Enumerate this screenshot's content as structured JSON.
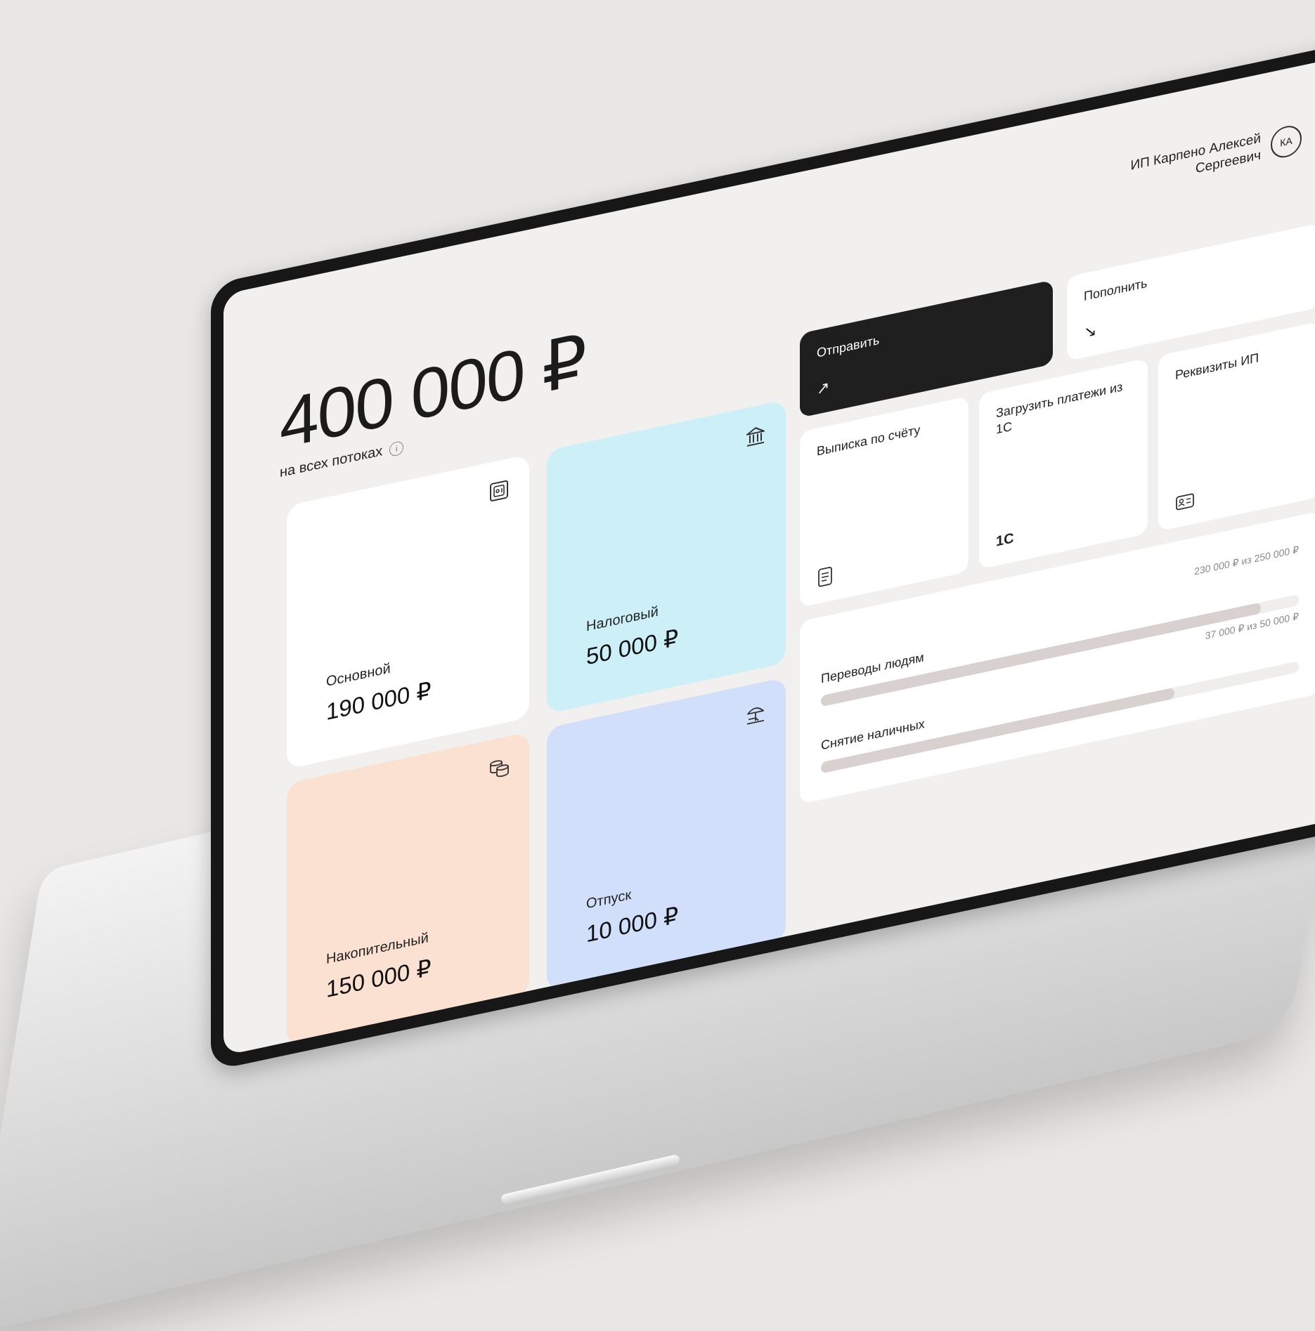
{
  "user": {
    "name_line1": "ИП Карпено Алексей",
    "name_line2": "Сергеевич",
    "initials": "КА"
  },
  "summary": {
    "total": "400 000 ₽",
    "caption": "на всех потоках",
    "info_glyph": "i"
  },
  "accounts": [
    {
      "label": "Основной",
      "amount": "190 000 ₽",
      "icon": "safe-icon",
      "color": "#ffffff"
    },
    {
      "label": "Налоговый",
      "amount": "50 000 ₽",
      "icon": "bank-icon",
      "color": "#cdeff8"
    },
    {
      "label": "Накопительный",
      "amount": "150 000 ₽",
      "icon": "coins-icon",
      "color": "#fbe1d2"
    },
    {
      "label": "Отпуск",
      "amount": "10 000 ₽",
      "icon": "beach-umbrella-icon",
      "color": "#d2dffa"
    }
  ],
  "actions": {
    "send": {
      "label": "Отправить",
      "icon": "arrow-up-right-icon",
      "glyph": "↗"
    },
    "topup": {
      "label": "Пополнить",
      "icon": "arrow-down-right-icon",
      "glyph": "↘"
    },
    "statement": {
      "label": "Выписка по счёту",
      "icon": "document-icon"
    },
    "import_1c": {
      "label": "Загрузить платежи из 1С",
      "icon": "1c-icon",
      "glyph": "1С"
    },
    "requisites": {
      "label": "Реквизиты ИП",
      "icon": "id-card-icon"
    }
  },
  "limits": [
    {
      "name": "Переводы людям",
      "text": "230 000 ₽ из 250 000 ₽",
      "used": 230000,
      "total": 250000
    },
    {
      "name": "Снятие наличных",
      "text": "37 000 ₽ из 50 000 ₽",
      "used": 37000,
      "total": 50000
    }
  ]
}
